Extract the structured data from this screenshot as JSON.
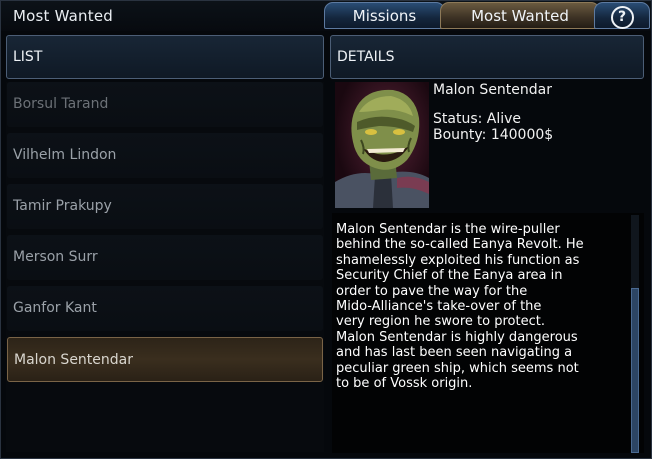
{
  "window": {
    "title": "Most Wanted"
  },
  "tabs": [
    {
      "label": "Missions",
      "active": false
    },
    {
      "label": "Most Wanted",
      "active": true
    },
    {
      "label": "?",
      "icon": "help-icon"
    }
  ],
  "list": {
    "header": "LIST",
    "items": [
      {
        "label": "Borsul Tarand"
      },
      {
        "label": "Vilhelm Lindon"
      },
      {
        "label": "Tamir Prakupy"
      },
      {
        "label": "Merson Surr"
      },
      {
        "label": "Ganfor Kant"
      },
      {
        "label": "Malon Sentendar",
        "selected": true
      }
    ]
  },
  "details": {
    "header": "DETAILS",
    "name": "Malon Sentendar",
    "status": "Status: Alive",
    "bounty": "Bounty: 140000$",
    "portrait_icon": "alien-portrait",
    "bio": "Malon Sentendar is the wire-puller\nbehind the so-called Eanya Revolt. He\nshamelessly exploited his function as\nSecurity Chief of the Eanya area in\norder to pave the way for the\nMido-Alliance's take-over of the\nvery region he swore to protect.\nMalon Sentendar is highly dangerous\nand has last been seen navigating a\npeculiar green ship, which seems not\nto be of Vossk origin."
  },
  "colors": {
    "tab_active": "#3f3426",
    "tab_inactive": "#14263d",
    "selected_row": "#3a2e1e",
    "background": "#05080c"
  }
}
